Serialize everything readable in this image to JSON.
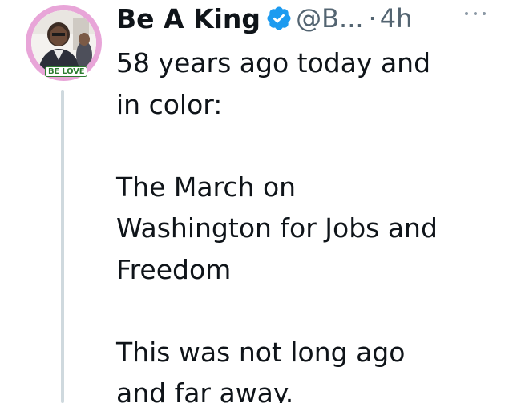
{
  "author": {
    "display_name": "Be A King",
    "handle": "@B...",
    "separator": "·",
    "timestamp": "4h",
    "avatar_badge_text": "BE LOVE",
    "verified": true
  },
  "tweet": {
    "lines": [
      "58 years ago today and",
      "in color:",
      "",
      "The March on",
      "Washington for Jobs and",
      "Freedom",
      "",
      "This was not long ago",
      "and far away."
    ]
  },
  "icons": {
    "verified": "verified-badge-icon",
    "more": "more-options-icon"
  },
  "colors": {
    "verified_blue": "#1d9bf0",
    "avatar_ring": "#e8a5d8",
    "thread_line": "#cfd9de",
    "secondary_text": "#536471"
  }
}
